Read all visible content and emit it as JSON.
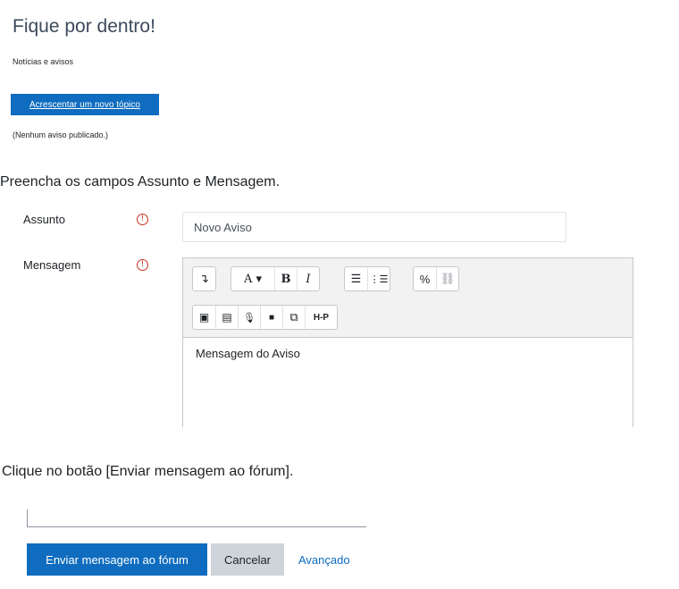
{
  "header": {
    "title": "Fique por dentro!",
    "subtitle": "Notícias e avisos",
    "new_topic_label": "Acrescentar um novo tópico",
    "no_news_text": "(Nenhum aviso publicado.)"
  },
  "instructions": {
    "step1": "Preencha os campos Assunto e Mensagem.",
    "step2": "Clique no botão [Enviar mensagem ao fórum]."
  },
  "form": {
    "subject_label": "Assunto",
    "subject_value": "Novo Aviso",
    "message_label": "Mensagem",
    "message_value": "Mensagem do Aviso",
    "required_icon": "!",
    "toolbar_row1": [
      {
        "icon": "collapse-icon",
        "glyph": "↴"
      },
      {
        "icon": "font-style-icon",
        "glyph": "A ▾"
      },
      {
        "icon": "bold-icon",
        "glyph": "B"
      },
      {
        "icon": "italic-icon",
        "glyph": "I"
      },
      {
        "icon": "unordered-list-icon",
        "glyph": "☰"
      },
      {
        "icon": "ordered-list-icon",
        "glyph": "⋮☰"
      },
      {
        "icon": "link-icon",
        "glyph": "%"
      },
      {
        "icon": "unlink-icon",
        "glyph": "⛓"
      }
    ],
    "toolbar_row2": [
      {
        "icon": "image-icon",
        "glyph": "▣"
      },
      {
        "icon": "media-icon",
        "glyph": "▤"
      },
      {
        "icon": "microphone-icon",
        "glyph": "🎙"
      },
      {
        "icon": "video-icon",
        "glyph": "■"
      },
      {
        "icon": "copy-icon",
        "glyph": "⧉"
      },
      {
        "icon": "h5p-icon",
        "glyph": "H-P"
      }
    ]
  },
  "actions": {
    "submit_label": "Enviar mensagem ao fórum",
    "cancel_label": "Cancelar",
    "advanced_label": "Avançado"
  },
  "colors": {
    "primary": "#0f6cbf",
    "danger": "#ca3120",
    "title": "#3c4a5b"
  }
}
